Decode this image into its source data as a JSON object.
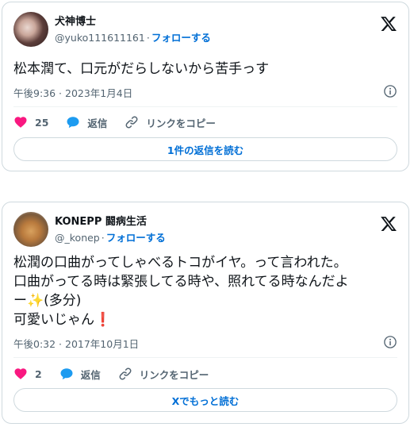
{
  "tweets": [
    {
      "display_name": "犬神博士",
      "handle": "@yuko111611161",
      "follow": "フォローする",
      "text_lines": [
        "松本潤て、口元がだらしないから苦手っす"
      ],
      "timestamp": "午後9:36 · 2023年1月4日",
      "likes": "25",
      "reply_label": "返信",
      "copy_link_label": "リンクをコピー",
      "read_label": "1件の返信を読む"
    },
    {
      "display_name": "KONEPP 闘病生活",
      "handle": "@_konep",
      "follow": "フォローする",
      "text_lines": [
        "松潤の口曲がってしゃべるトコがイヤ。って言われた。",
        "口曲がってる時は緊張してる時や、照れてる時なんだよ",
        "ー✨(多分)",
        "可愛いじゃん❗"
      ],
      "timestamp": "午後0:32 · 2017年10月1日",
      "likes": "2",
      "reply_label": "返信",
      "copy_link_label": "リンクをコピー",
      "read_label": "Xでもっと読む"
    }
  ],
  "colors": {
    "like": "#f91880",
    "reply": "#1d9bf0",
    "link": "#006fd6",
    "muted": "#536471"
  },
  "icons": [
    "x-logo-icon",
    "heart-icon",
    "reply-bubble-icon",
    "link-icon",
    "info-icon"
  ]
}
